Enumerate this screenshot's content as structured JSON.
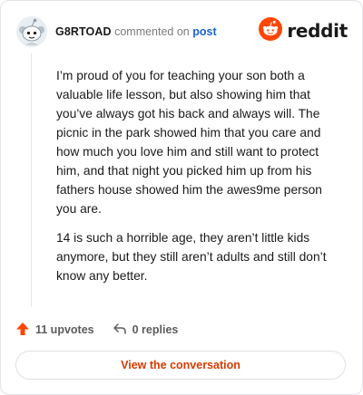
{
  "comment": {
    "username": "G8RTOAD",
    "commented_text": "commented on",
    "post_link": "post",
    "paragraphs": [
      "I’m proud of you for teaching your son both a valuable life lesson, but also showing him that you’ve always got his back and always will. The picnic in the park showed him that you care and how much you love him and still want to protect him, and that night you picked him up from his fathers house showed him the awes9me person you are.",
      "14 is such a horrible age, they aren’t little kids anymore, but they still aren’t adults and still don’t know any better."
    ],
    "upvotes": "11 upvotes",
    "replies": "0 replies"
  },
  "brand": {
    "name": "reddit",
    "color": "#ff4500"
  },
  "cta": {
    "label": "View the conversation",
    "color": "#d93a00"
  },
  "icons": {
    "avatar": "snoo-avatar-icon",
    "logo": "reddit-logo-icon",
    "upvote": "upvote-arrow-icon",
    "reply": "reply-arrow-icon"
  }
}
